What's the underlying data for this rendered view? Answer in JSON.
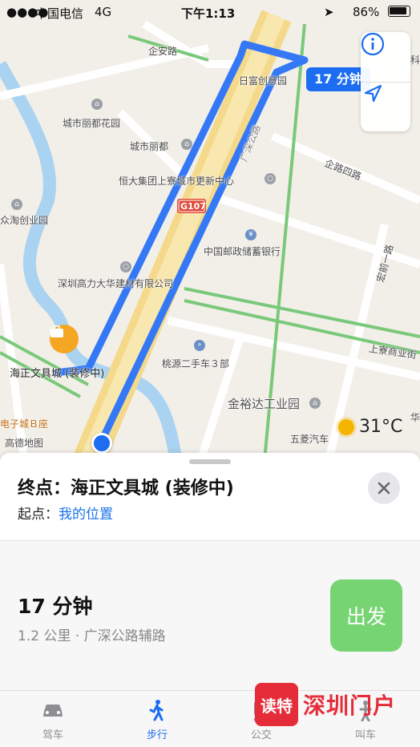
{
  "status_bar": {
    "carrier": "中国电信",
    "network": "4G",
    "time": "下午1:13",
    "battery": "86%"
  },
  "map": {
    "labels": {
      "qi_an_road": "企安路",
      "chengshi_lidu_huayuan": "城市丽都花园",
      "chengshi_lidu": "城市丽都",
      "hengda": "恒大集团上寮城市更新中心",
      "ri_fu": "日富创意园",
      "qi_road_4": "企路四路",
      "zhong_chuang": "众淘创业园",
      "guangshen_road": "广深公路",
      "shield": "G107",
      "postal_bank": "中国邮政储蓄银行",
      "gaoli": "深圳高力大华建材有限公司",
      "taoyuan": "桃源二手车３部",
      "haizheng": "海正文具城 (装修中)",
      "jinyuda": "金裕达工业园",
      "dianzi_b": "电子城Ｂ座",
      "gaode": "高德地图",
      "wuling": "五菱汽车",
      "shangliao_street": "上寮商业街",
      "hongqian_road": "宏前一路",
      "hua": "华",
      "ke": "科"
    },
    "eta_bubble": "17 分钟",
    "weather": "31°C"
  },
  "sheet": {
    "destination_label": "终点：",
    "destination_name": "海正文具城 (装修中)",
    "origin_label": "起点：",
    "origin_value": "我的位置",
    "duration": "17 分钟",
    "detail": "1.2 公里 · 广深公路辅路",
    "go_label": "出发"
  },
  "tabs": [
    {
      "label": "驾车",
      "icon": "car-icon"
    },
    {
      "label": "步行",
      "icon": "walk-icon",
      "active": true
    },
    {
      "label": "公交",
      "icon": "transit-icon"
    },
    {
      "label": "叫车",
      "icon": "ride-icon"
    }
  ],
  "watermark": {
    "badge": "读特",
    "text": "深圳门户"
  },
  "colors": {
    "route": "#3478f6",
    "accent": "#1c6df2",
    "go": "#76d472"
  }
}
